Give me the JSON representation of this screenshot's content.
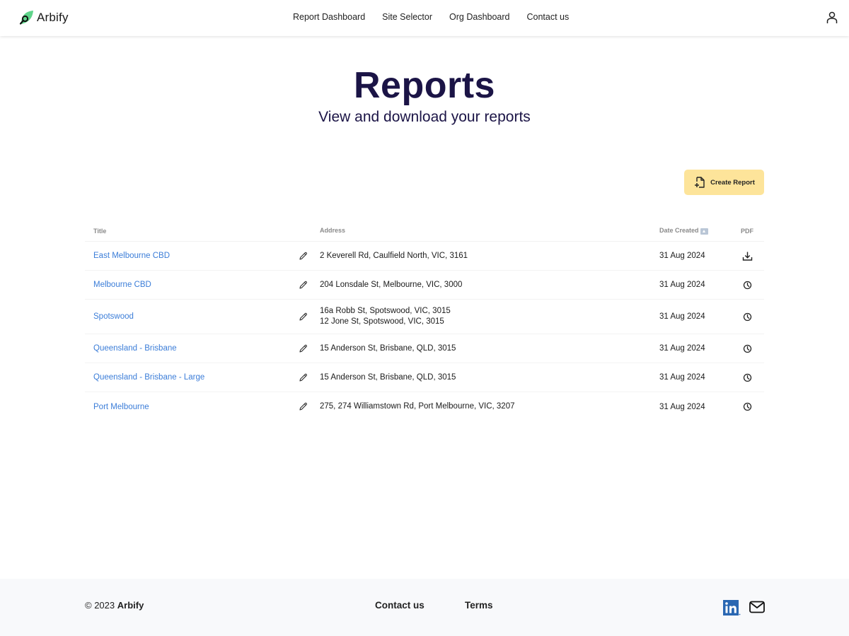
{
  "app": {
    "name": "Arbify",
    "brand_color": "#5fd48a"
  },
  "nav": {
    "links": [
      {
        "label": "Report Dashboard"
      },
      {
        "label": "Site Selector"
      },
      {
        "label": "Org Dashboard"
      },
      {
        "label": "Contact us"
      }
    ],
    "user_icon": "user-icon"
  },
  "hero": {
    "title": "Reports",
    "subtitle": "View and download your reports"
  },
  "toolbar": {
    "create_label": "Create Report",
    "create_icon": "file-plus-icon",
    "button_color": "#fde49a"
  },
  "table": {
    "columns": {
      "title": "Title",
      "address": "Address",
      "date": "Date Created",
      "pdf": "PDF"
    },
    "sort": {
      "column": "date",
      "direction": "ascending"
    },
    "rows": [
      {
        "title": "East Melbourne CBD",
        "address": [
          "2 Keverell Rd, Caulfield North, VIC, 3161"
        ],
        "date": "31 Aug 2024",
        "pdf_status": "download"
      },
      {
        "title": "Melbourne CBD",
        "address": [
          "204 Lonsdale St, Melbourne, VIC, 3000"
        ],
        "date": "31 Aug 2024",
        "pdf_status": "pending"
      },
      {
        "title": "Spotswood",
        "address": [
          "16a Robb St, Spotswood, VIC, 3015",
          "12 Jone St, Spotswood, VIC, 3015"
        ],
        "date": "31 Aug 2024",
        "pdf_status": "pending"
      },
      {
        "title": "Queensland - Brisbane",
        "address": [
          "15 Anderson St, Brisbane, QLD, 3015"
        ],
        "date": "31 Aug 2024",
        "pdf_status": "pending"
      },
      {
        "title": "Queensland - Brisbane - Large",
        "address": [
          "15 Anderson St, Brisbane, QLD, 3015"
        ],
        "date": "31 Aug 2024",
        "pdf_status": "pending"
      },
      {
        "title": "Port Melbourne",
        "address": [
          "275, 274 Williamstown Rd, Port Melbourne, VIC, 3207"
        ],
        "date": "31 Aug 2024",
        "pdf_status": "pending"
      }
    ]
  },
  "footer": {
    "copyright_prefix": "© 2023",
    "copyright_brand": "Arbify",
    "links": [
      {
        "label": "Contact us"
      },
      {
        "label": "Terms"
      }
    ],
    "social": [
      "linkedin-icon",
      "mail-icon"
    ]
  }
}
